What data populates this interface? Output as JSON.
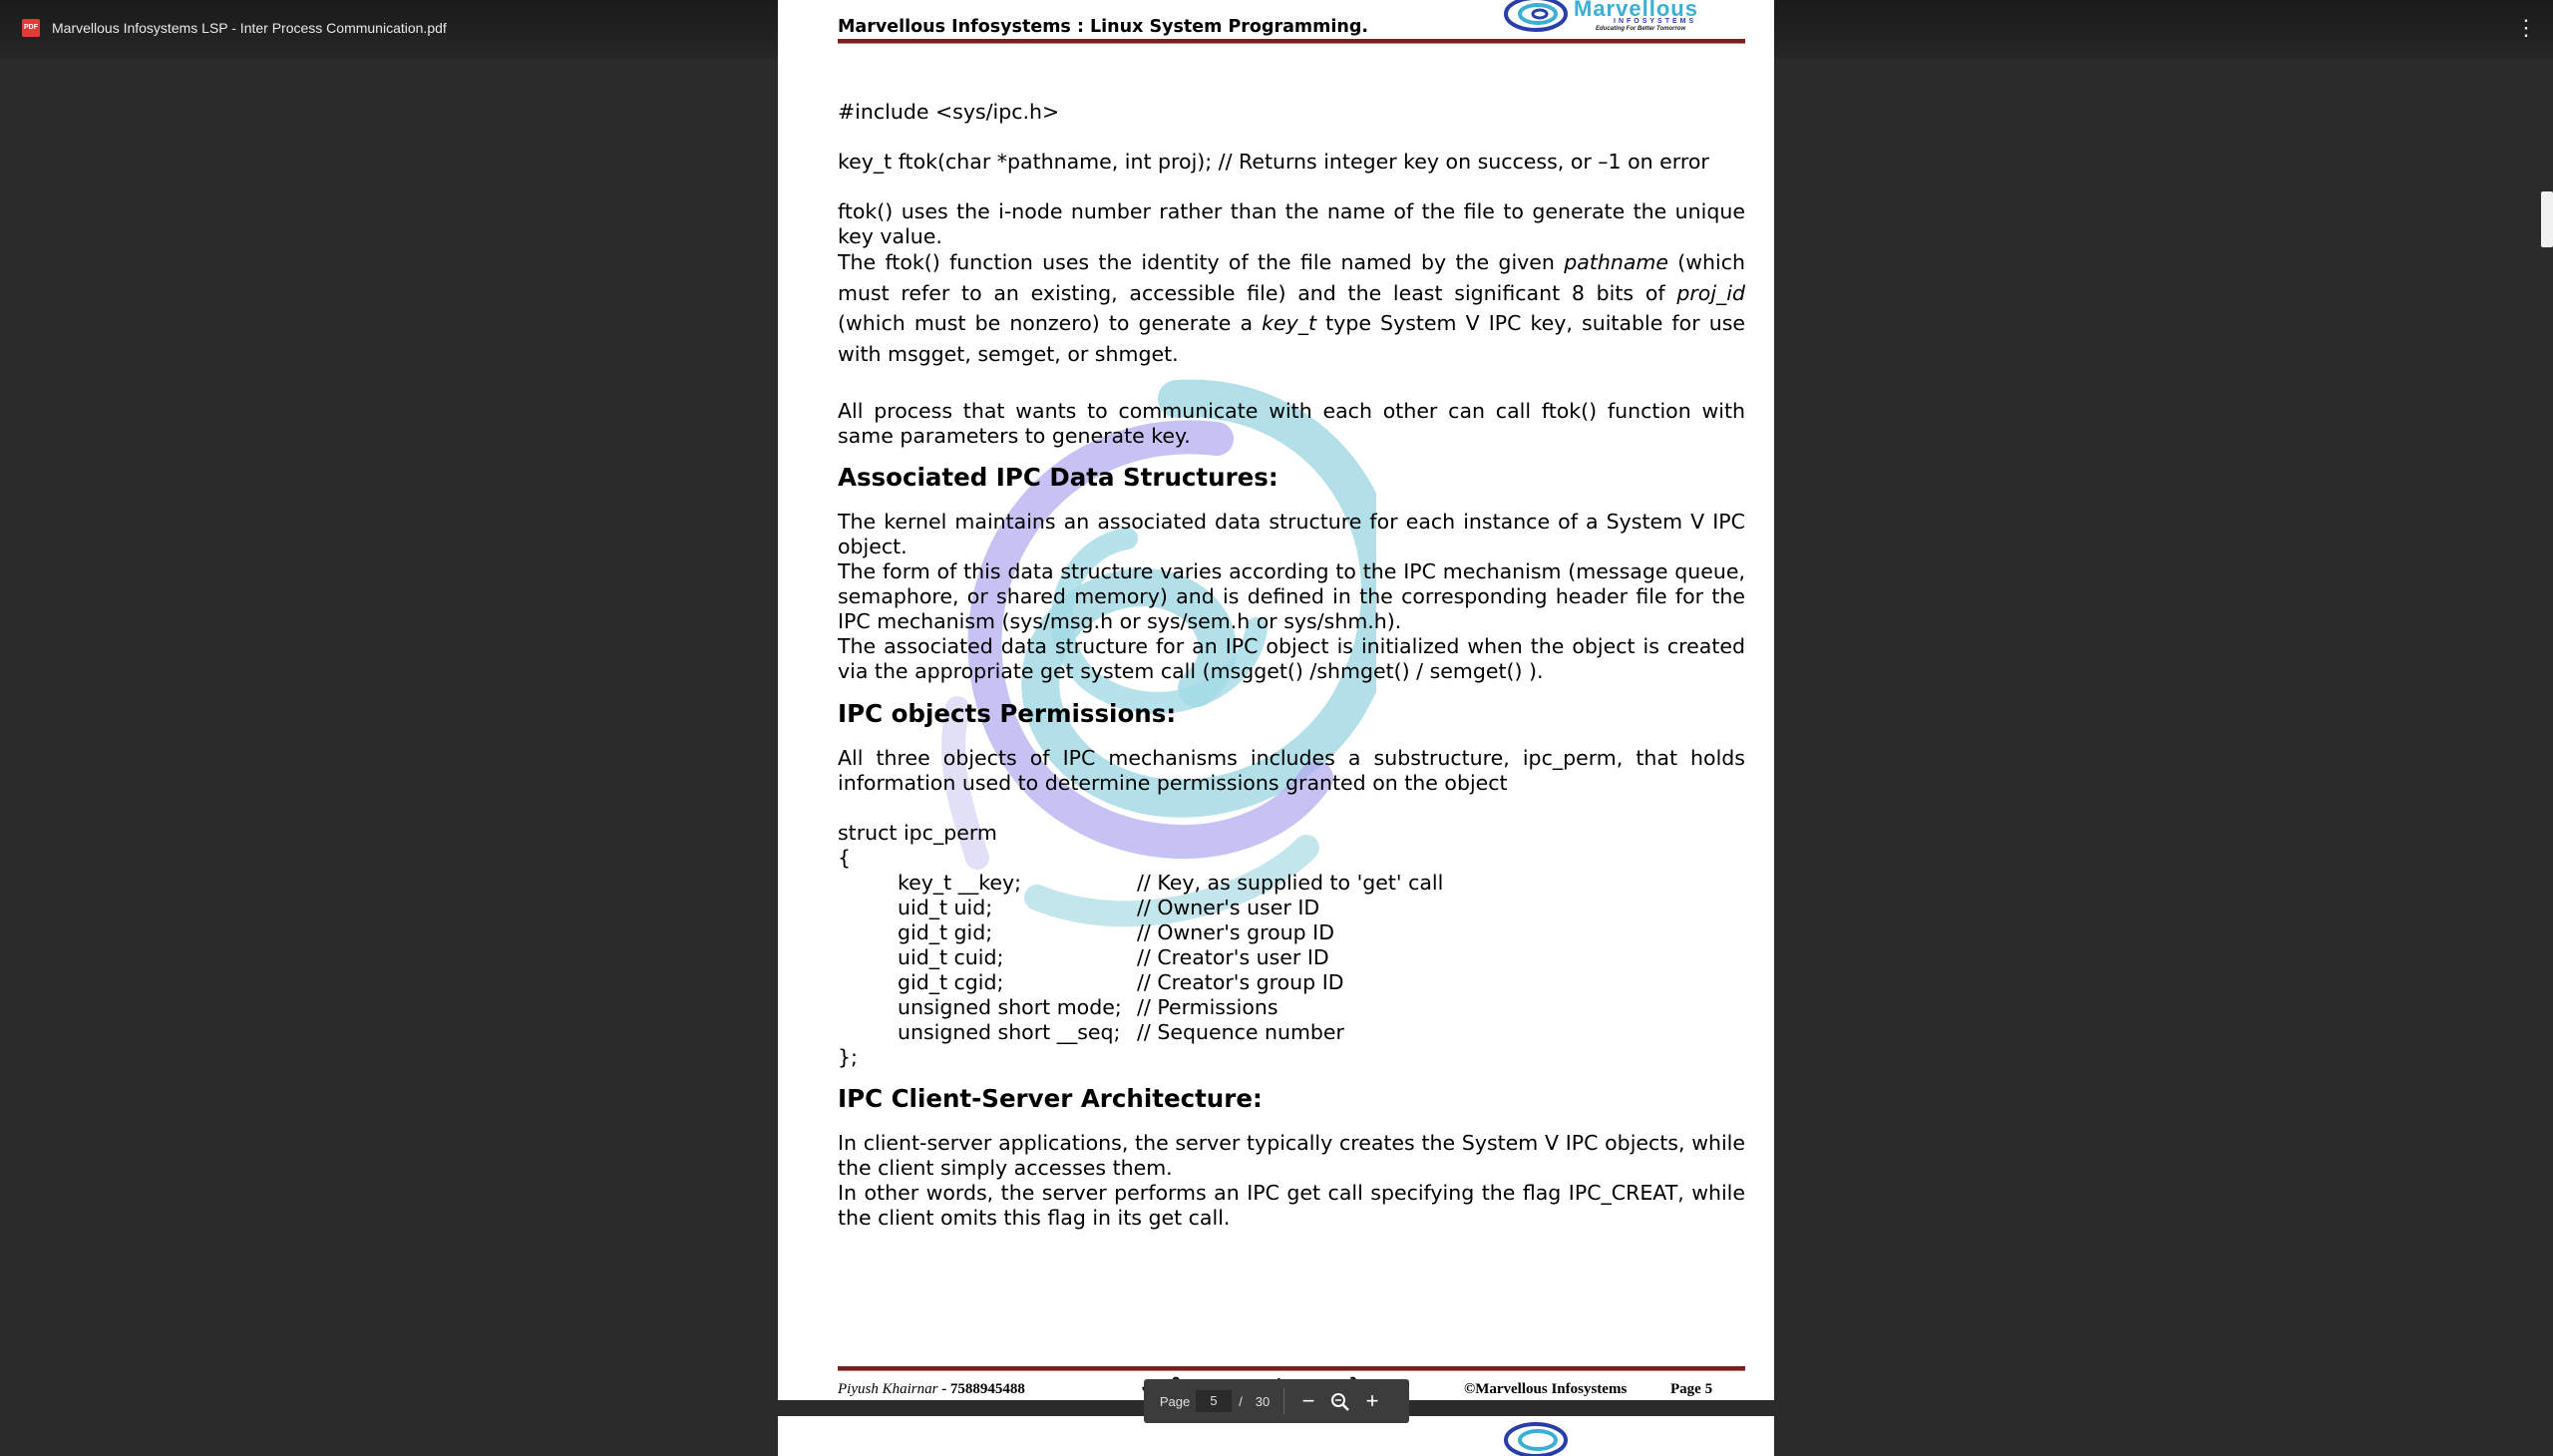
{
  "viewer": {
    "file_title": "Marvellous Infosystems LSP - Inter Process Communication.pdf",
    "pdf_icon": "pdf-file-icon",
    "more_icon": "more-vert-icon"
  },
  "page_header": {
    "title": "Marvellous Infosystems : Linux System Programming.",
    "logo_name": "Marvellous",
    "logo_sub": "INFOSYSTEMS",
    "logo_tag": "Educating For Better Tomorrow"
  },
  "body": {
    "include": "#include <sys/ipc.h>",
    "prototype": "key_t ftok(char *pathname, int proj); // Returns integer key on success, or –1 on error",
    "p1": "ftok() uses the i-node number rather than the name of the file to generate the unique key value.",
    "p2_a": "The ftok() function uses the identity of the file named by the given ",
    "p2_b": "pathname",
    "p2_c": " (which must refer to an existing, accessible file) and the least significant 8 bits of ",
    "p2_d": "proj_id",
    "p2_e": " (which must be nonzero) to generate a ",
    "p2_f": "key_t",
    "p2_g": " type System V IPC key, suitable for use with msgget, semget, or shmget.",
    "p3": "All process that wants to communicate with each other can call ftok() function with same parameters to generate key.",
    "h_assoc": "Associated IPC Data Structures:",
    "p4": "The kernel maintains an associated data structure for each instance of a System V IPC object.",
    "p5": "The form of this data structure varies according to the IPC mechanism (message queue, semaphore, or shared memory) and is defined in the corresponding header file for the IPC mechanism (sys/msg.h or sys/sem.h or sys/shm.h).",
    "p6": "The associated data structure for an IPC object is initialized when the object is created via the appropriate get system call (msgget() /shmget() / semget() ).",
    "h_perm": "IPC objects Permissions:",
    "p7": "All three objects of IPC mechanisms includes a substructure, ipc_perm, that holds information used to determine permissions granted on the object",
    "struct_open": "struct ipc_perm",
    "brace_open": "{",
    "struct_fields": [
      {
        "decl": "key_t __key;",
        "comment": "// Key, as supplied to 'get' call"
      },
      {
        "decl": "uid_t uid;",
        "comment": "// Owner's user ID"
      },
      {
        "decl": "gid_t gid;",
        "comment": "// Owner's group ID"
      },
      {
        "decl": "uid_t cuid;",
        "comment": "// Creator's user ID"
      },
      {
        "decl": "gid_t cgid;",
        "comment": "// Creator's group ID"
      },
      {
        "decl": "unsigned short mode;",
        "comment": "// Permissions"
      },
      {
        "decl": "unsigned short __seq;",
        "comment": "// Sequence number"
      }
    ],
    "brace_close": "};",
    "h_client": "IPC Client-Server Architecture:",
    "p8": "In client-server applications, the server typically creates the System V IPC objects, while the client simply accesses them.",
    "p9": "In other words, the server performs an IPC get call specifying the flag IPC_CREAT, while the client omits this flag in its get call."
  },
  "page_footer": {
    "author": "Piyush Khairnar",
    "phone": " - 7588945488",
    "slogan": "आम्ही Technical संस्कार करतो !!!",
    "copyright": "©Marvellous Infosystems",
    "page_label": "Page ",
    "page_num": "5"
  },
  "page_nav": {
    "label": "Page",
    "current": "5",
    "separator": "/",
    "total": "30",
    "zoom_out": "−",
    "zoom_in": "+"
  }
}
